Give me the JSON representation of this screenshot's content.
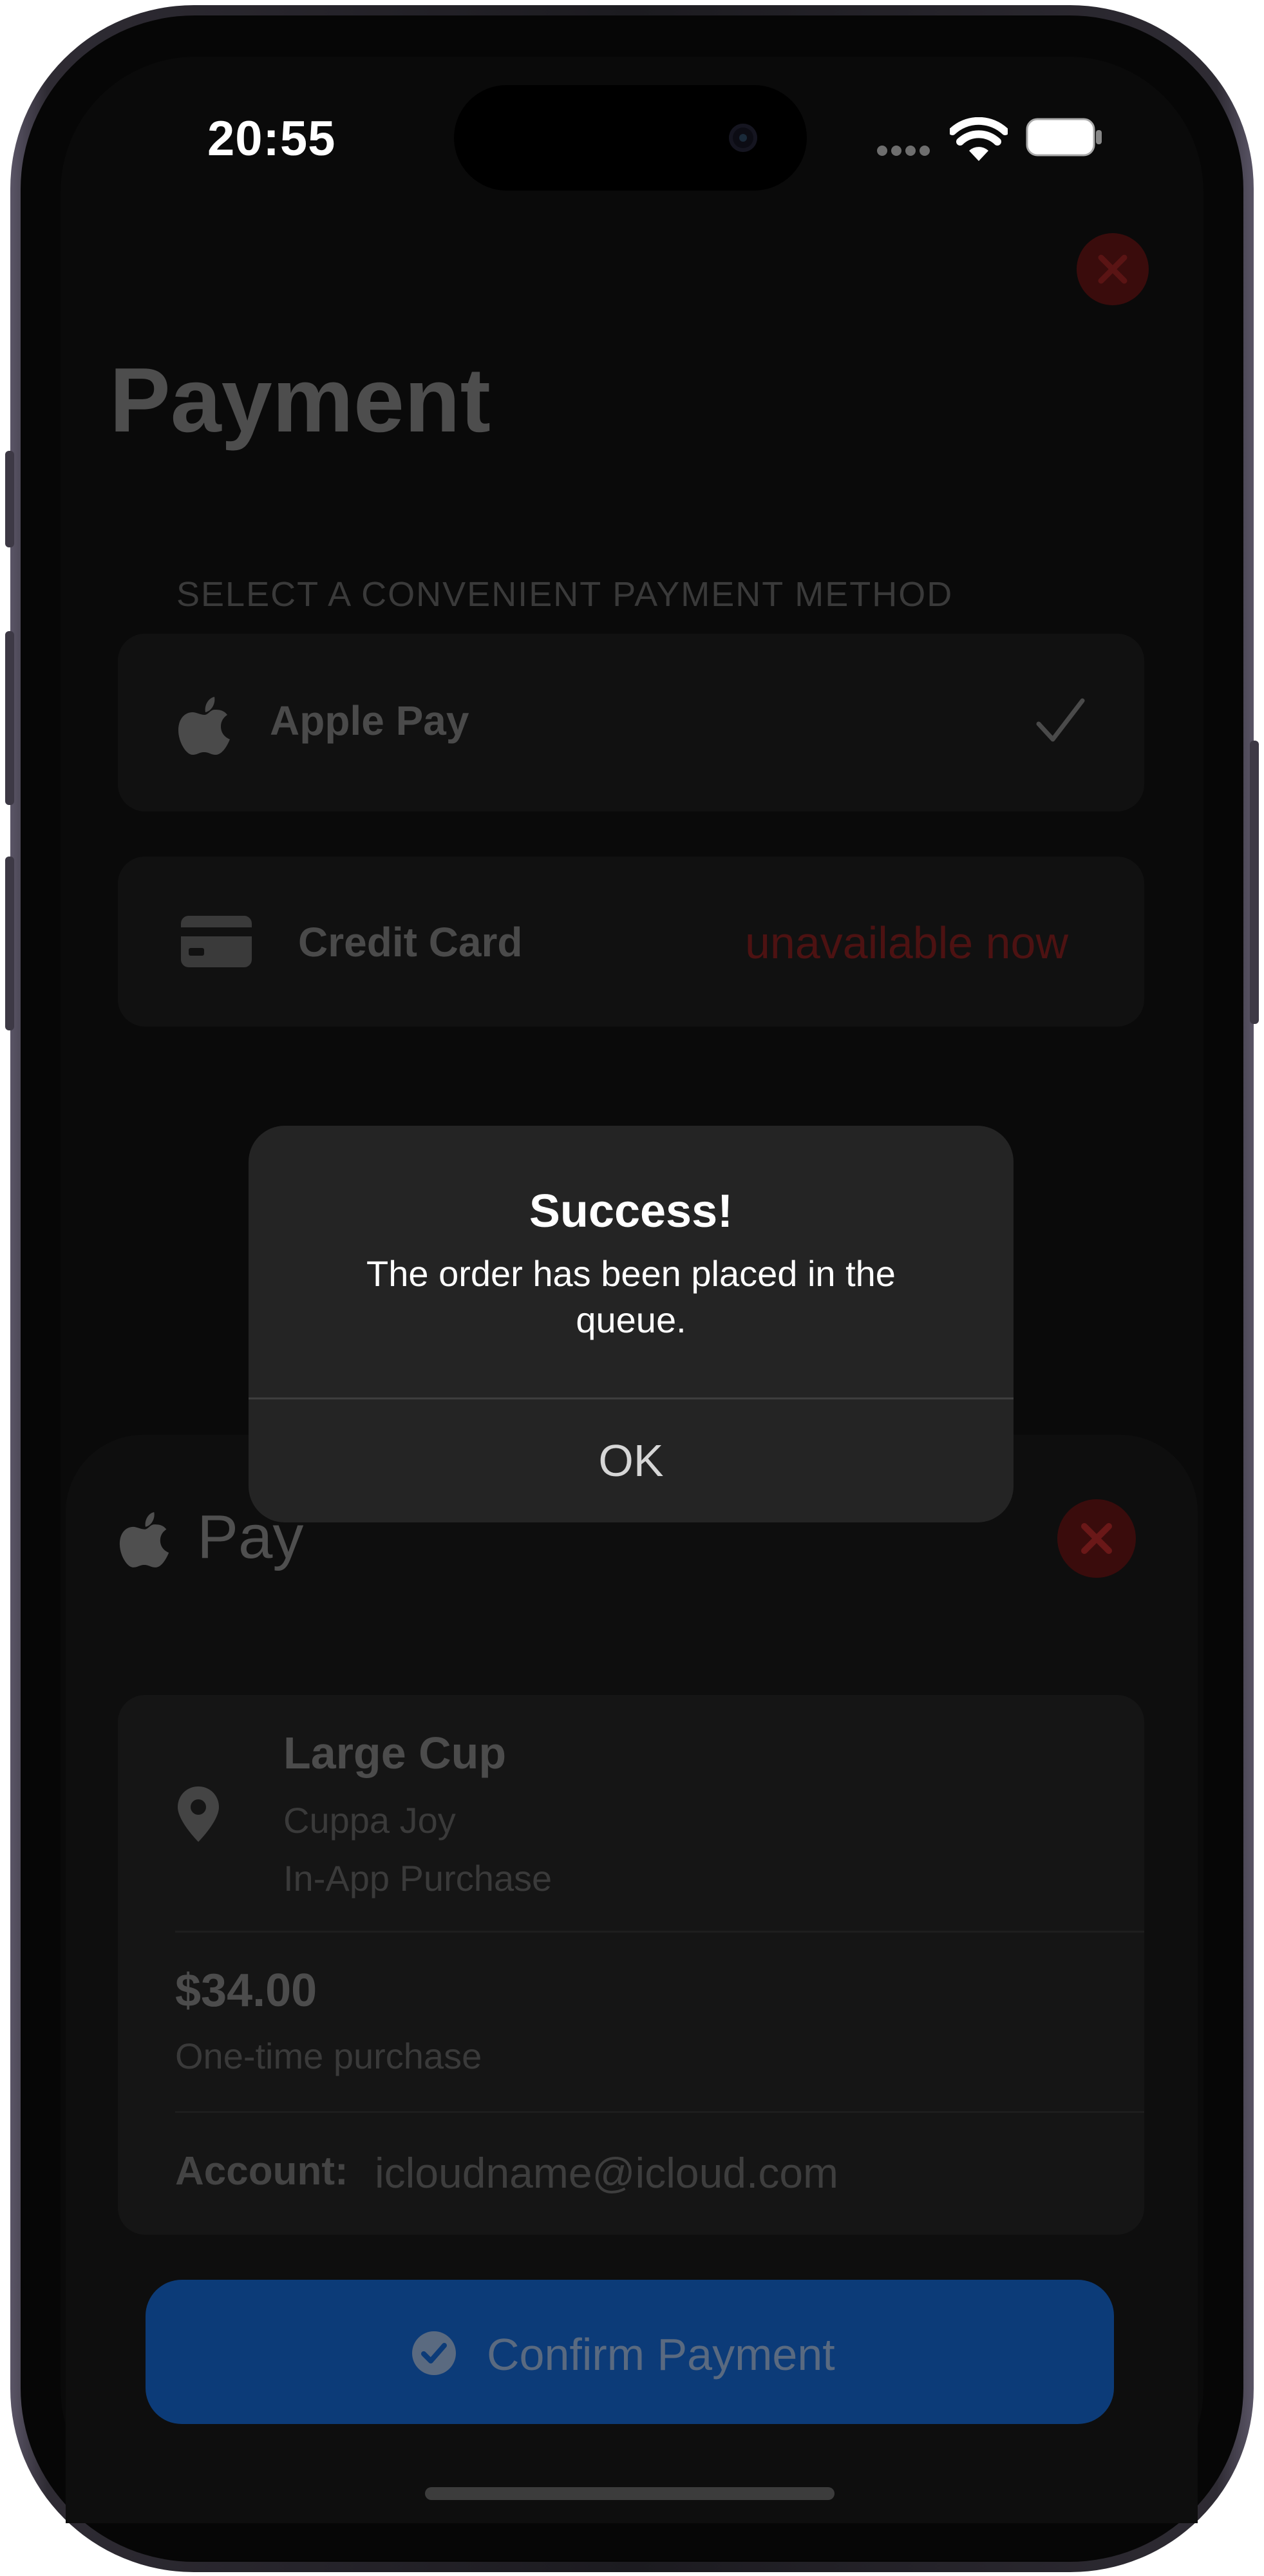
{
  "status_bar": {
    "time": "20:55",
    "signal_icon": "cellular-dots-icon",
    "wifi_icon": "wifi-icon",
    "battery_icon": "battery-icon"
  },
  "payment_screen": {
    "title": "Payment",
    "section_header": "SELECT A CONVENIENT PAYMENT METHOD",
    "methods": [
      {
        "label": "Apple Pay",
        "icon": "apple-logo-icon",
        "selected": true
      },
      {
        "label": "Credit Card",
        "icon": "credit-card-icon",
        "status": "unavailable now"
      }
    ],
    "close_icon": "close-icon"
  },
  "apple_pay_sheet": {
    "brand_word": "Pay",
    "item_name": "Large Cup",
    "merchant": "Cuppa Joy",
    "purchase_type": "In-App Purchase",
    "price": "$34.00",
    "price_note": "One-time purchase",
    "account_label": "Account:",
    "account_value": "icloudname@icloud.com",
    "confirm_label": "Confirm Payment"
  },
  "alert": {
    "title": "Success!",
    "message": "The order has been placed in the queue.",
    "ok_label": "OK"
  },
  "colors": {
    "accent_blue": "#0c3b78",
    "destructive_red": "#4d1212",
    "alert_background": "#242424"
  }
}
